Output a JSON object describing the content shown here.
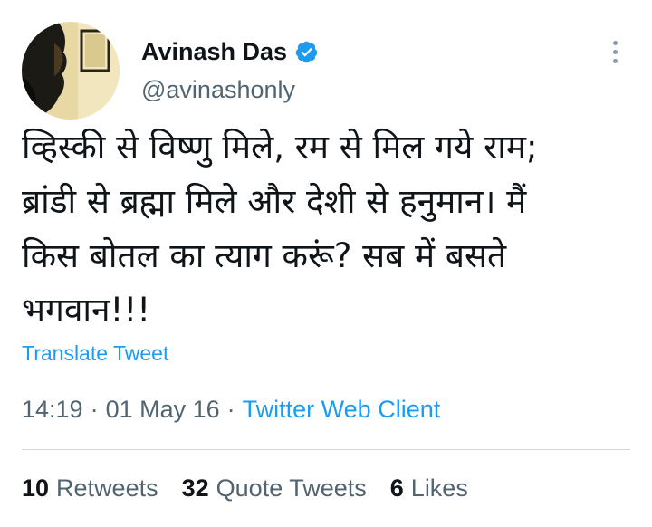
{
  "author": {
    "display_name": "Avinash Das",
    "handle": "@avinashonly",
    "verified": true,
    "avatar_icon": "user-avatar-photo"
  },
  "tweet": {
    "text_lines": [
      "व्हिस्की से विष्णु मिले, रम से मिल गये राम;",
      "ब्रांडी से ब्रह्मा मिले और देशी से हनुमान। मैं",
      "किस बोतल का त्याग करूं? सब में बसते",
      "भगवान!!!"
    ],
    "translate_label": "Translate Tweet",
    "time": "14:19",
    "separator": "·",
    "date": "01 May 16",
    "source": "Twitter Web Client"
  },
  "stats": {
    "retweets_count": "10",
    "retweets_label": "Retweets",
    "quote_count": "32",
    "quote_label": "Quote Tweets",
    "likes_count": "6",
    "likes_label": "Likes"
  },
  "colors": {
    "accent": "#1d9bf0",
    "secondary_text": "#536471",
    "primary_text": "#0f1419",
    "divider": "#cfd9de"
  }
}
